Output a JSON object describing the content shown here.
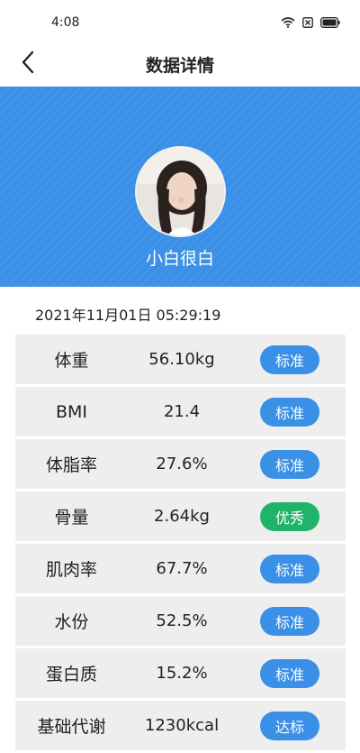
{
  "status_bar": {
    "time": "4:08"
  },
  "nav": {
    "title": "数据详情"
  },
  "profile": {
    "name": "小白很白"
  },
  "record": {
    "timestamp": "2021年11月01日 05:29:19"
  },
  "metrics": [
    {
      "label": "体重",
      "value": "56.10kg",
      "status": "标准",
      "status_color": "#3a8fe6"
    },
    {
      "label": "BMI",
      "value": "21.4",
      "status": "标准",
      "status_color": "#3a8fe6"
    },
    {
      "label": "体脂率",
      "value": "27.6%",
      "status": "标准",
      "status_color": "#3a8fe6"
    },
    {
      "label": "骨量",
      "value": "2.64kg",
      "status": "优秀",
      "status_color": "#1fb46a"
    },
    {
      "label": "肌肉率",
      "value": "67.7%",
      "status": "标准",
      "status_color": "#3a8fe6"
    },
    {
      "label": "水份",
      "value": "52.5%",
      "status": "标准",
      "status_color": "#3a8fe6"
    },
    {
      "label": "蛋白质",
      "value": "15.2%",
      "status": "标准",
      "status_color": "#3a8fe6"
    },
    {
      "label": "基础代谢",
      "value": "1230kcal",
      "status": "达标",
      "status_color": "#3a8fe6"
    }
  ],
  "colors": {
    "header_blue": "#3a8fe6",
    "badge_blue": "#3a8fe6",
    "badge_green": "#1fb46a",
    "row_bg": "#eeeeee"
  }
}
